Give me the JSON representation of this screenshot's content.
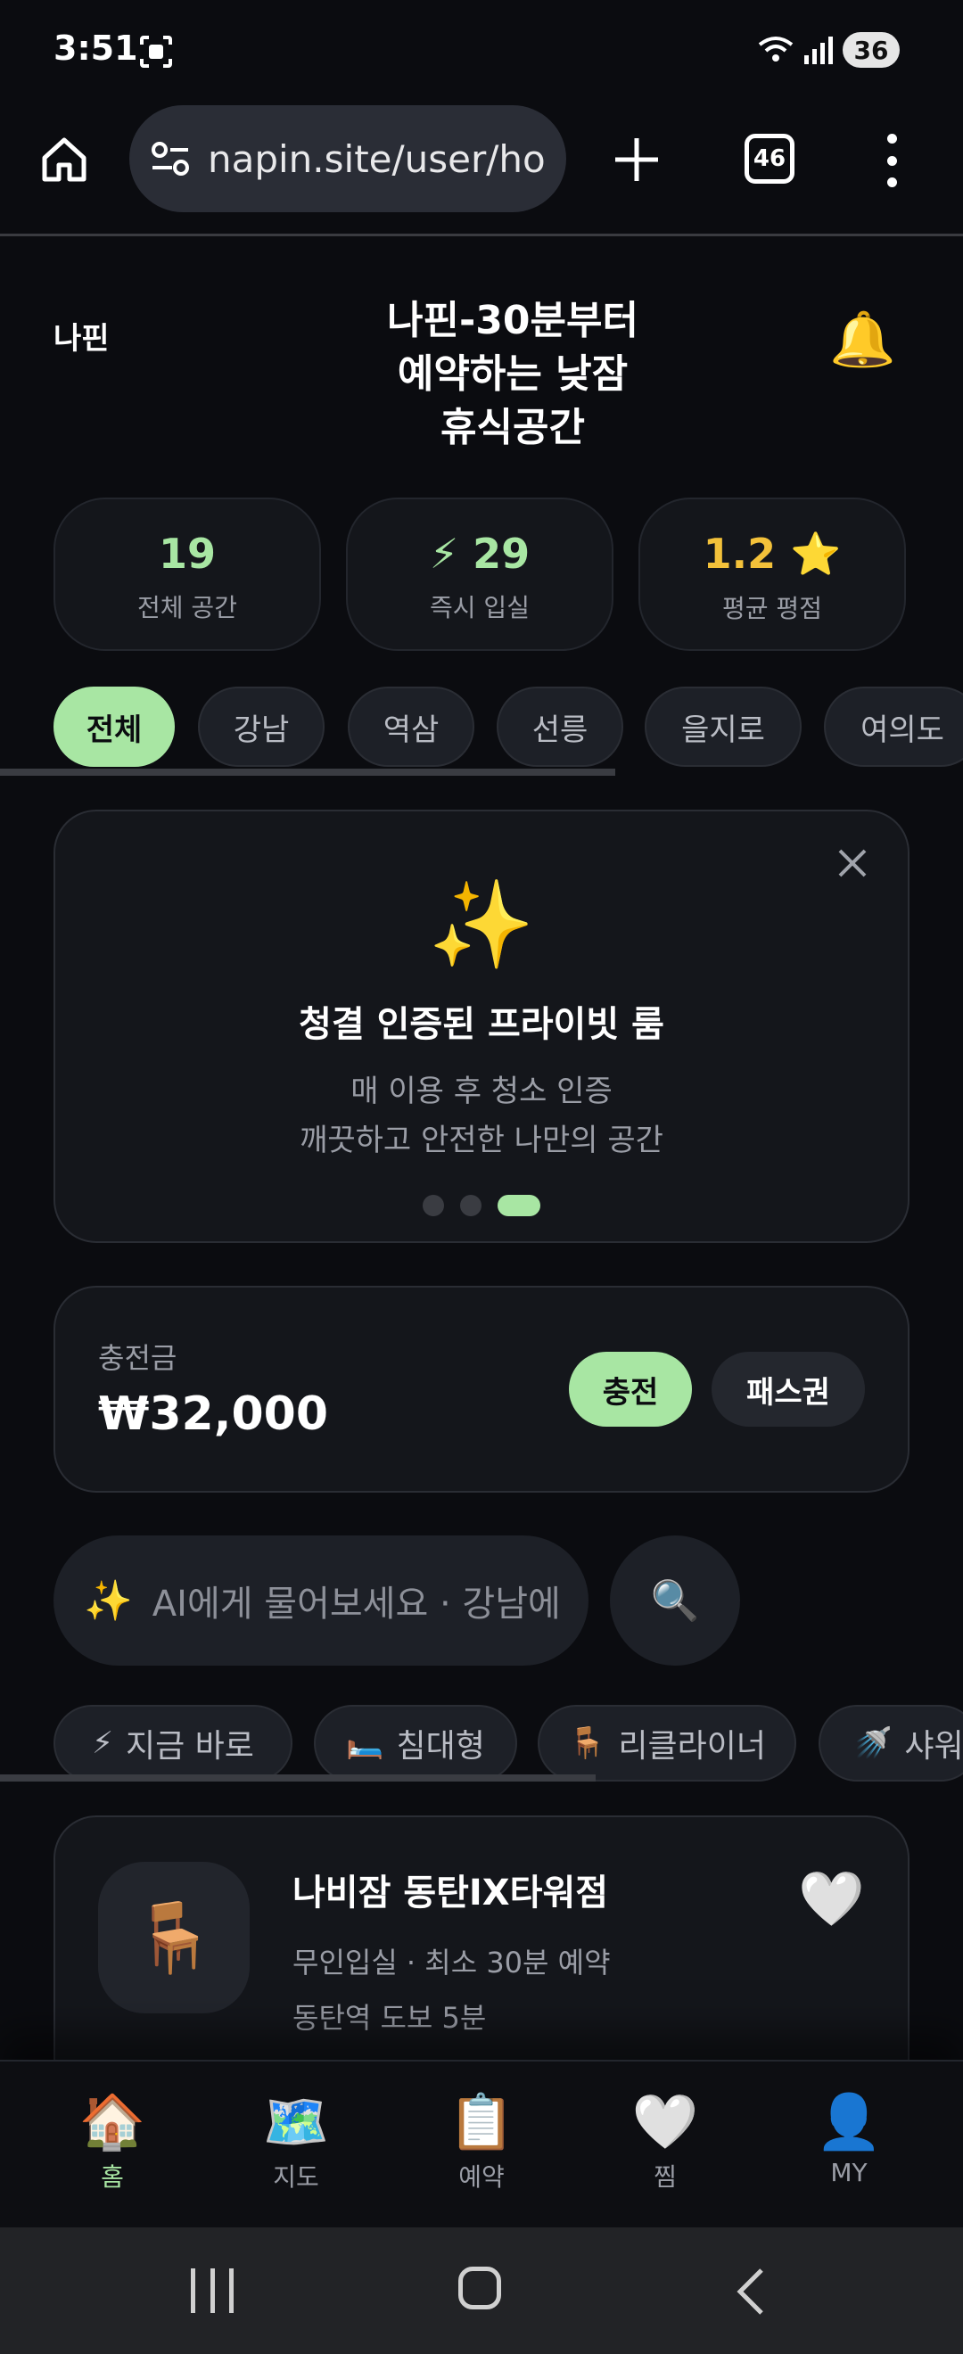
{
  "status_bar": {
    "time": "3:51",
    "battery": "36"
  },
  "browser": {
    "url": "napin.site/user/ho",
    "tab_count": "46"
  },
  "header": {
    "brand": "나핀",
    "title_lines": [
      "나핀-30분부터",
      "예약하는 낮잠",
      "휴식공간"
    ],
    "bell_icon": "🔔"
  },
  "stats": [
    {
      "value": "19",
      "label": "전체 공간"
    },
    {
      "value": "⚡ 29",
      "label": "즉시 입실"
    },
    {
      "value": "1.2 ⭐",
      "label": "평균 평점"
    }
  ],
  "regions": [
    "전체",
    "강남",
    "역삼",
    "선릉",
    "을지로",
    "여의도"
  ],
  "banner": {
    "icon": "✨",
    "title": "청결 인증된 프라이빗 룸",
    "desc1": "매 이용 후 청소 인증",
    "desc2": "깨끗하고 안전한 나만의 공간",
    "active_dot": 3,
    "dot_count": 3
  },
  "balance": {
    "label": "충전금",
    "amount": "₩32,000",
    "charge_label": "충전",
    "pass_label": "패스권"
  },
  "ai_search": {
    "icon": "✨",
    "placeholder": "AI에게 물어보세요 · 강남에",
    "search_icon": "🔍"
  },
  "filters": [
    {
      "icon": "⚡",
      "label": "지금 바로"
    },
    {
      "icon": "🛏️",
      "label": "침대형"
    },
    {
      "icon": "🪑",
      "label": "리클라이너"
    },
    {
      "icon": "🚿",
      "label": "샤워실"
    }
  ],
  "listing": {
    "thumb_icon": "🪑",
    "name": "나비잠 동탄IX타워점",
    "meta": "무인입실 · 최소 30분 예약",
    "location": "동탄역 도보 5분",
    "heart_icon": "🤍"
  },
  "bottom_nav": [
    {
      "icon": "🏠",
      "label": "홈"
    },
    {
      "icon": "🗺️",
      "label": "지도"
    },
    {
      "icon": "📋",
      "label": "예약"
    },
    {
      "icon": "🤍",
      "label": "찜"
    },
    {
      "icon": "👤",
      "label": "MY"
    }
  ],
  "colors": {
    "accent": "#a8e6a3",
    "rating": "#f3c13a",
    "background": "#0b0c10",
    "card": "#14161b"
  }
}
